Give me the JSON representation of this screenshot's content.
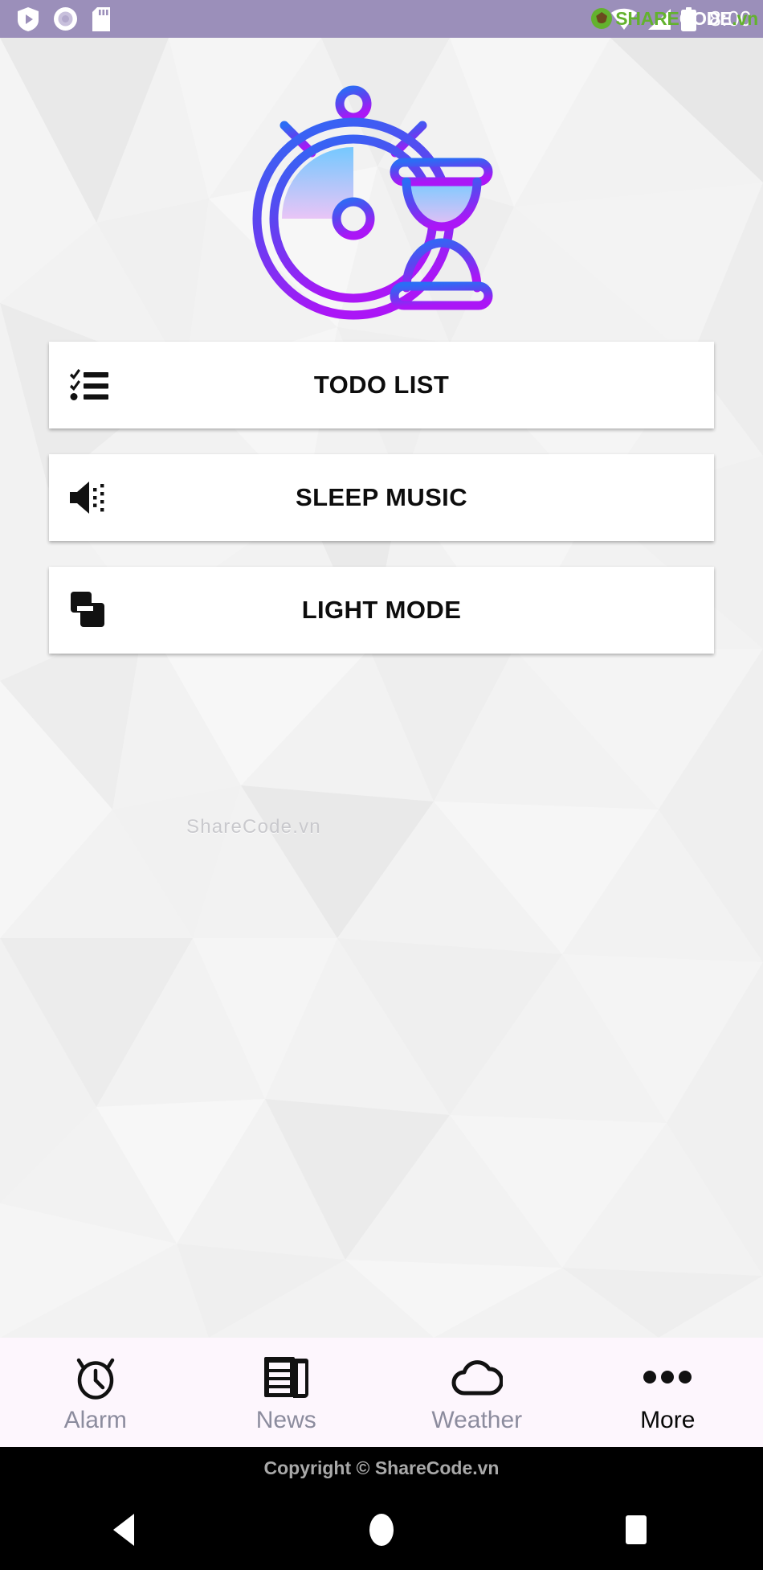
{
  "status_bar": {
    "time": "8:00",
    "left_icons": [
      "play-protect-icon",
      "disc-icon",
      "sd-card-icon"
    ],
    "right_icons": [
      "wifi-icon",
      "signal-icon",
      "battery-icon"
    ],
    "watermark": {
      "share": "SHARE",
      "code": "CODE",
      "vn": ".vn"
    },
    "background_color": "#9b8fba"
  },
  "logo": {
    "name": "stopwatch-hourglass-logo",
    "gradient_start": "#2b6df5",
    "gradient_end": "#a815f5",
    "fill_start": "#6ec6ff",
    "fill_end": "#e5bdf5"
  },
  "menu": {
    "items": [
      {
        "icon": "checklist-icon",
        "label": "TODO LIST"
      },
      {
        "icon": "speaker-waves-icon",
        "label": "SLEEP MUSIC"
      },
      {
        "icon": "layers-flip-icon",
        "label": "LIGHT MODE"
      }
    ]
  },
  "center_watermark": "ShareCode.vn",
  "tab_bar": {
    "background_color": "#fdf6fd",
    "active_color": "#080808",
    "inactive_color": "#8c8c9e",
    "tabs": [
      {
        "icon": "alarm-clock-icon",
        "label": "Alarm",
        "active": false
      },
      {
        "icon": "newspaper-icon",
        "label": "News",
        "active": false
      },
      {
        "icon": "cloud-icon",
        "label": "Weather",
        "active": false
      },
      {
        "icon": "more-dots-icon",
        "label": "More",
        "active": true
      }
    ]
  },
  "copyright": "Copyright © ShareCode.vn",
  "android_nav": {
    "buttons": [
      "back-triangle-icon",
      "home-circle-icon",
      "recents-square-icon"
    ]
  }
}
